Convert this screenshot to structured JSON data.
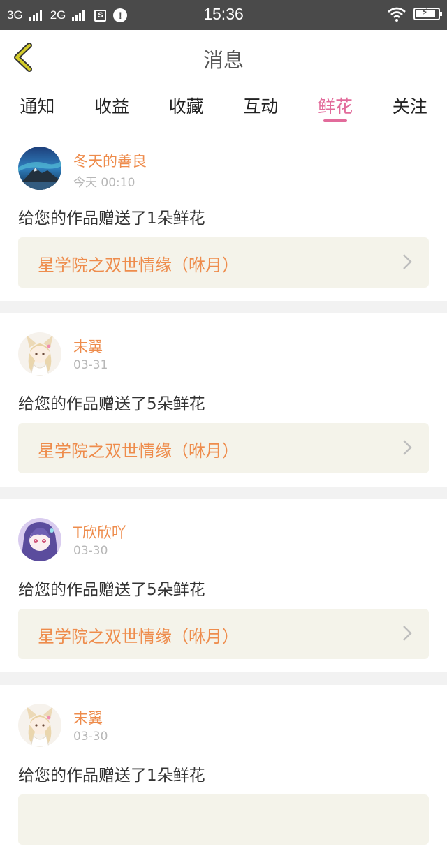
{
  "status_bar": {
    "net1": "3G",
    "net2": "2G",
    "sim_icon_text": "S",
    "msg_icon_text": "!",
    "time": "15:36"
  },
  "header": {
    "title": "消息"
  },
  "tabs": [
    {
      "label": "通知",
      "active": false
    },
    {
      "label": "收益",
      "active": false
    },
    {
      "label": "收藏",
      "active": false
    },
    {
      "label": "互动",
      "active": false
    },
    {
      "label": "鲜花",
      "active": true
    },
    {
      "label": "关注",
      "active": false
    }
  ],
  "colors": {
    "accent_pink": "#e26b9b",
    "name_orange": "#ee8c4c",
    "card_bg": "#f4f3ea",
    "statusbar_bg": "#4a4a4a",
    "back_arrow": "#c9c022"
  },
  "messages": [
    {
      "avatar": "avatar-landscape",
      "name": "冬天的善良",
      "time": "今天 00:10",
      "text": "给您的作品赠送了1朵鲜花",
      "work": "星学院之双世情缘（咻月）"
    },
    {
      "avatar": "avatar-anime-fox",
      "name": "末翼",
      "time": "03-31",
      "text": "给您的作品赠送了5朵鲜花",
      "work": "星学院之双世情缘（咻月）"
    },
    {
      "avatar": "avatar-anime-girl",
      "name": "T欣欣吖",
      "time": "03-30",
      "text": "给您的作品赠送了5朵鲜花",
      "work": "星学院之双世情缘（咻月）"
    },
    {
      "avatar": "avatar-anime-fox",
      "name": "末翼",
      "time": "03-30",
      "text": "给您的作品赠送了1朵鲜花",
      "work": ""
    }
  ]
}
